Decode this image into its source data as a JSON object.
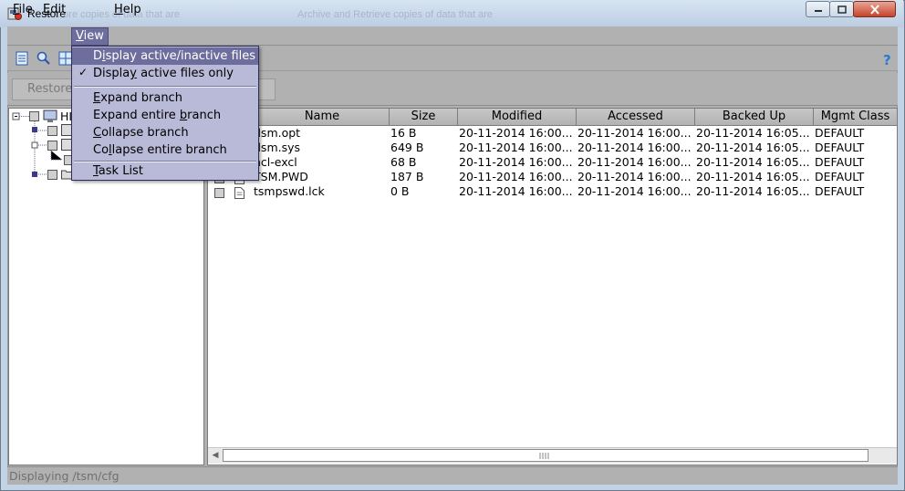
{
  "window": {
    "title": "Restore",
    "ghost_text_1": "...ore copies of data that are",
    "ghost_text_2": "Archive and Retrieve copies of data that are"
  },
  "menubar": {
    "file": {
      "pre": "",
      "key": "F",
      "post": "ile"
    },
    "edit": {
      "pre": "",
      "key": "E",
      "post": "dit"
    },
    "view": {
      "pre": "",
      "key": "V",
      "post": "iew"
    },
    "help": {
      "pre": "",
      "key": "H",
      "post": "elp"
    }
  },
  "view_menu": {
    "items": [
      {
        "pre": "D",
        "key": "i",
        "post": "splay active/inactive files",
        "checked": false,
        "highlighted": true
      },
      {
        "pre": "Displa",
        "key": "y",
        "post": " active files only",
        "checked": true
      },
      {
        "pre": "",
        "key": "E",
        "post": "xpand branch"
      },
      {
        "pre": "Expand entire ",
        "key": "b",
        "post": "ranch"
      },
      {
        "pre": "",
        "key": "C",
        "post": "ollapse branch"
      },
      {
        "pre": "Co",
        "key": "l",
        "post": "lapse entire branch"
      },
      {
        "pre": "",
        "key": "T",
        "post": "ask List"
      }
    ],
    "check_glyph": "✓"
  },
  "actionbar": {
    "restore_label": "Restore"
  },
  "tree": {
    "root_label": "HI"
  },
  "list": {
    "columns": [
      "Name",
      "Size",
      "Modified",
      "Accessed",
      "Backed Up",
      "Mgmt Class"
    ],
    "rows": [
      {
        "name": "dsm.opt",
        "size": "16  B",
        "modified": "20-11-2014 16:00...",
        "accessed": "20-11-2014 16:00...",
        "backed_up": "20-11-2014 16:05...",
        "mgmt_class": "DEFAULT"
      },
      {
        "name": "dsm.sys",
        "size": "649  B",
        "modified": "20-11-2014 16:00...",
        "accessed": "20-11-2014 16:00...",
        "backed_up": "20-11-2014 16:05...",
        "mgmt_class": "DEFAULT"
      },
      {
        "name": "ncl-excl",
        "size": "68  B",
        "modified": "20-11-2014 16:00...",
        "accessed": "20-11-2014 16:00...",
        "backed_up": "20-11-2014 16:05...",
        "mgmt_class": "DEFAULT"
      },
      {
        "name": "TSM.PWD",
        "size": "187  B",
        "modified": "20-11-2014 16:00...",
        "accessed": "20-11-2014 16:00...",
        "backed_up": "20-11-2014 16:05...",
        "mgmt_class": "DEFAULT"
      },
      {
        "name": "tsmpswd.lck",
        "size": "0  B",
        "modified": "20-11-2014 16:00...",
        "accessed": "20-11-2014 16:00...",
        "backed_up": "20-11-2014 16:05...",
        "mgmt_class": "DEFAULT"
      }
    ]
  },
  "status": {
    "text": "Displaying /tsm/cfg"
  },
  "icons": {
    "app": "restore-app-icon",
    "toolbar": [
      "details-icon",
      "search-icon",
      "filter-icon",
      "help-icon"
    ],
    "file": "file-icon",
    "tree": [
      "computer-icon",
      "drive-icon",
      "folder-icon"
    ]
  },
  "colors": {
    "menu_highlight": "#6e6e9e",
    "menu_bg": "#b9b9d8",
    "client_bg": "#b1b1b1"
  }
}
